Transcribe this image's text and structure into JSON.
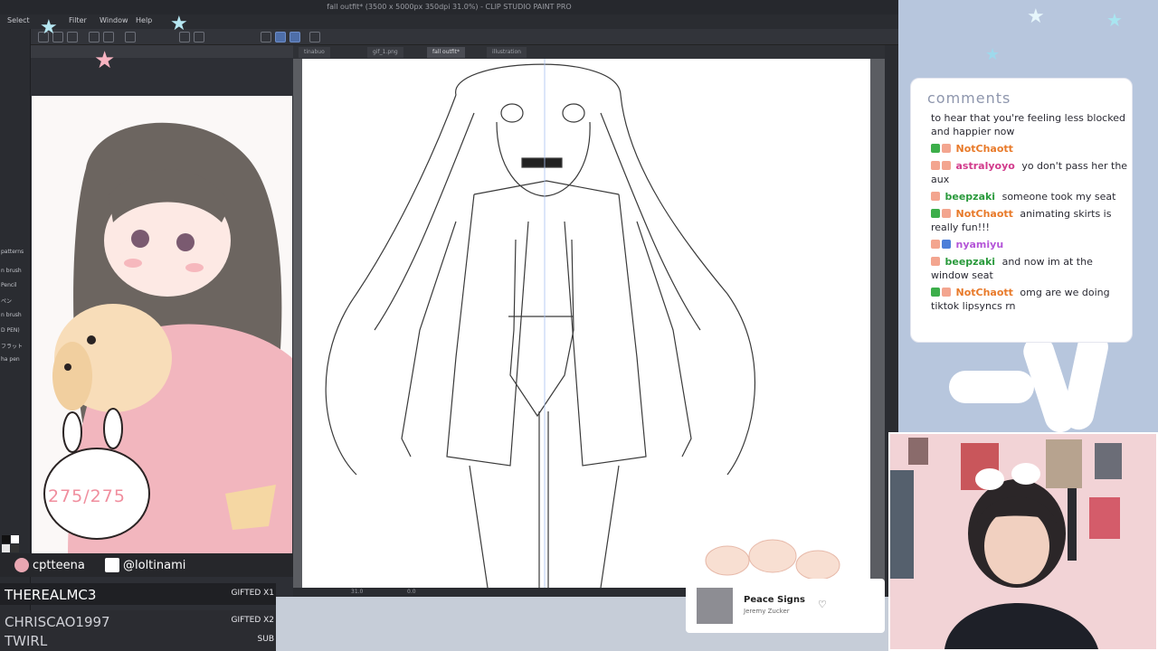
{
  "csp": {
    "title": "fall outfit* (3500 x 5000px 350dpi 31.0%) - CLIP STUDIO PAINT PRO",
    "menu": [
      "Select",
      "Filter",
      "Window",
      "Help"
    ],
    "doc_tabs": [
      "tinabuo",
      "gif_1.png",
      "fall outfit*",
      "illustration"
    ],
    "left_tool_labels": [
      "patterns",
      "n brush",
      "Pencil",
      "ペン",
      "n brush",
      "D PEN)",
      "フラット",
      "ha pen"
    ],
    "status_zoom": "31.0",
    "status_angle": "0.0"
  },
  "preview": {
    "counter": "275/275"
  },
  "social": {
    "spotify": "cptteena",
    "twitter": "@loltinami"
  },
  "gifts": [
    {
      "name": "THEREALMC3",
      "badge": "GIFTED X1"
    },
    {
      "name": "CHRISCAO1997",
      "badge": "GIFTED X2"
    },
    {
      "name": "TWIRL",
      "badge": "SUB"
    }
  ],
  "comments": {
    "title": "comments",
    "messages": [
      {
        "user": "",
        "text": "to hear that you're feeling less blocked and happier now"
      },
      {
        "user": "NotChaott",
        "text": ""
      },
      {
        "user": "astralyoyo",
        "text": "yo don't pass her the aux"
      },
      {
        "user": "beepzaki",
        "text": "someone took my seat"
      },
      {
        "user": "NotChaott",
        "text": "animating skirts is really fun!!!"
      },
      {
        "user": "nyamiyu",
        "text": ""
      },
      {
        "user": "beepzaki",
        "text": "and now im at the window seat"
      },
      {
        "user": "NotChaott",
        "text": "omg are we doing tiktok lipsyncs rn"
      }
    ]
  },
  "music": {
    "song": "Peace Signs",
    "artist": "Jeremy Zucker"
  },
  "colors": {
    "notchaott": "#e87a2a",
    "astralyoyo": "#d23b8c",
    "beepzaki": "#2a9a3c",
    "nyamiyu": "#b455d8",
    "accent_pink": "#f3b4c0"
  }
}
